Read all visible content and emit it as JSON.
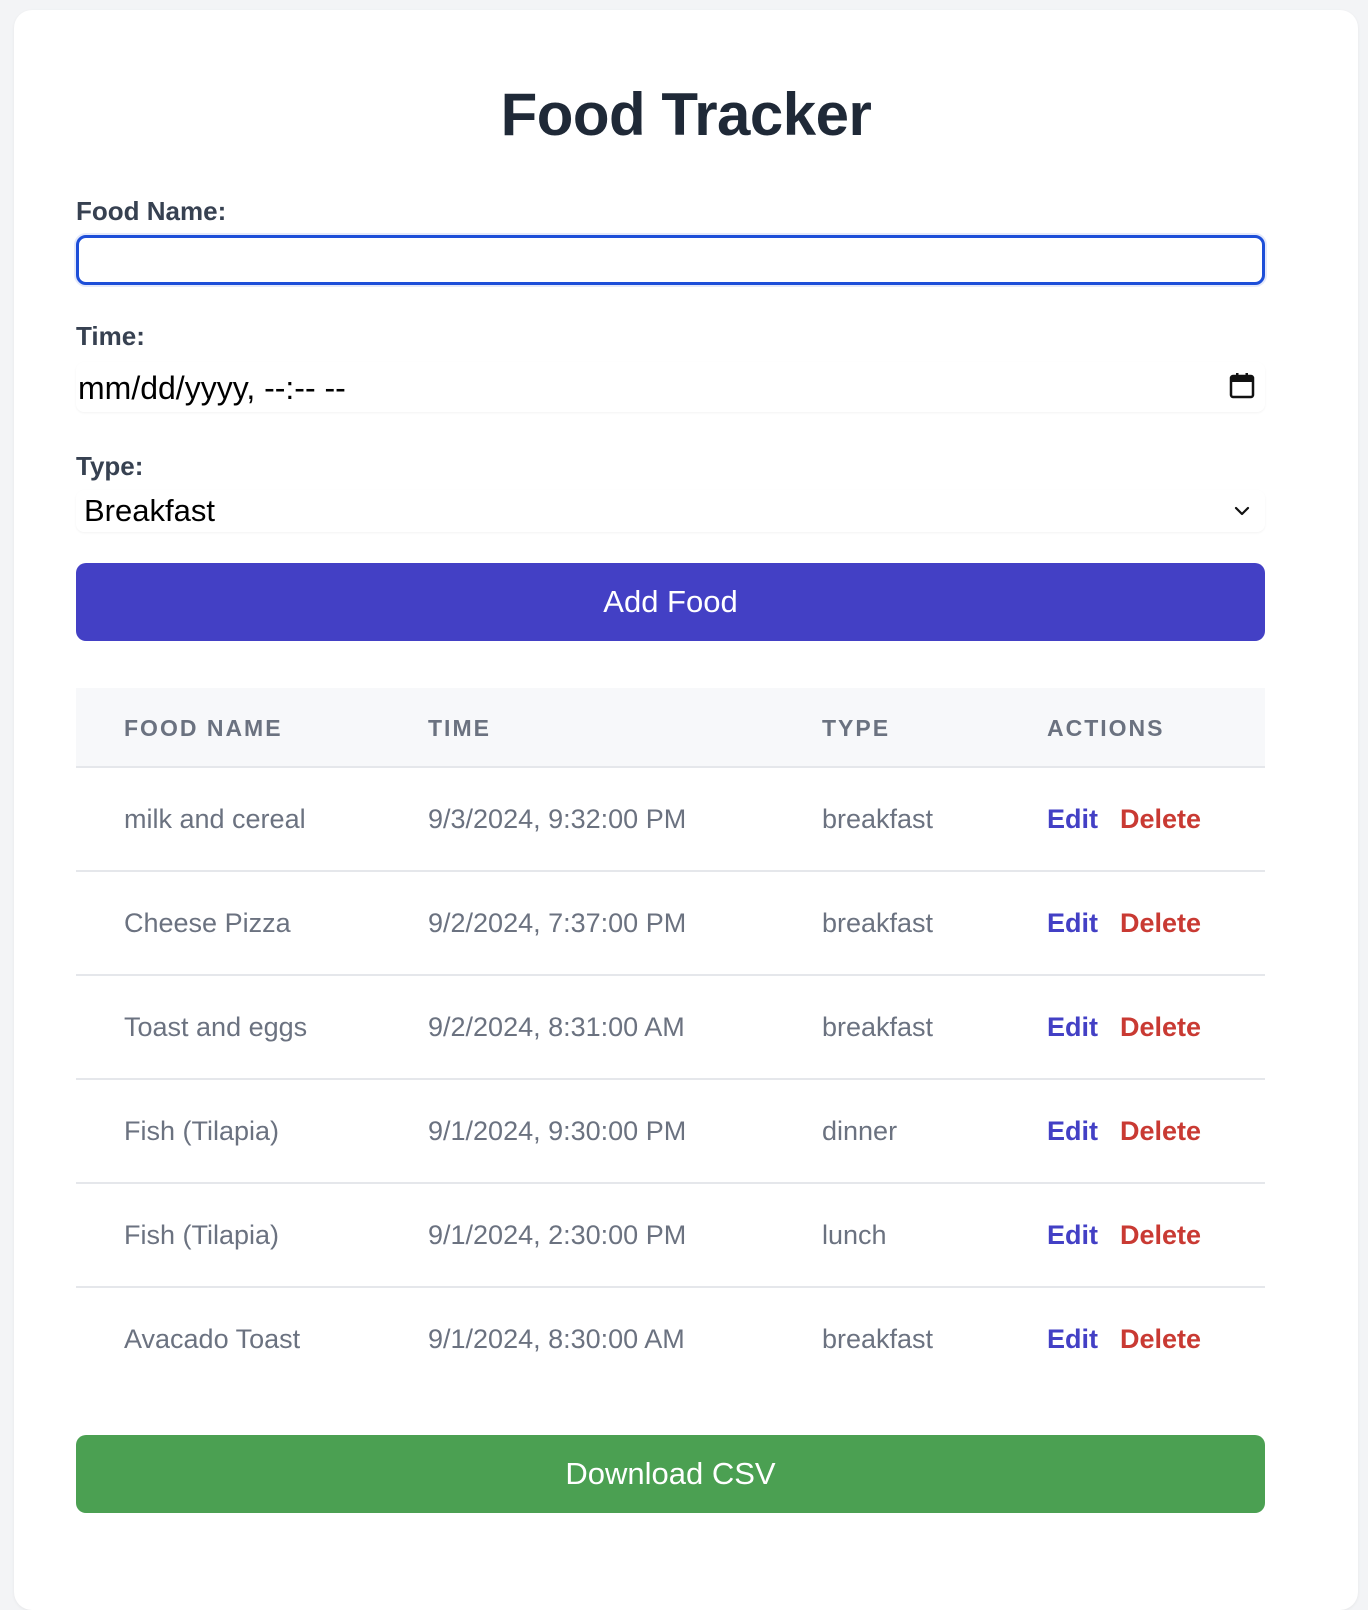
{
  "title": "Food Tracker",
  "form": {
    "food_name_label": "Food Name:",
    "food_name_value": "",
    "time_label": "Time:",
    "time_value": "mm/dd/yyyy, --:-- --",
    "type_label": "Type:",
    "type_value": "Breakfast",
    "add_button_label": "Add Food"
  },
  "table": {
    "headers": [
      "FOOD NAME",
      "TIME",
      "TYPE",
      "ACTIONS"
    ],
    "rows": [
      {
        "food": "milk and cereal",
        "time": "9/3/2024, 9:32:00 PM",
        "type": "breakfast"
      },
      {
        "food": "Cheese Pizza",
        "time": "9/2/2024, 7:37:00 PM",
        "type": "breakfast"
      },
      {
        "food": "Toast and eggs",
        "time": "9/2/2024, 8:31:00 AM",
        "type": "breakfast"
      },
      {
        "food": "Fish (Tilapia)",
        "time": "9/1/2024, 9:30:00 PM",
        "type": "dinner"
      },
      {
        "food": "Fish (Tilapia)",
        "time": "9/1/2024, 2:30:00 PM",
        "type": "lunch"
      },
      {
        "food": "Avacado Toast",
        "time": "9/1/2024, 8:30:00 AM",
        "type": "breakfast"
      }
    ],
    "edit_label": "Edit",
    "delete_label": "Delete"
  },
  "download_button_label": "Download CSV",
  "colors": {
    "primary": "#4340c5",
    "danger": "#c93a33",
    "success": "#4ba052",
    "focus": "#1d4ed8"
  },
  "icons": {
    "datetime": "calendar-icon",
    "select": "chevron-down-icon"
  }
}
